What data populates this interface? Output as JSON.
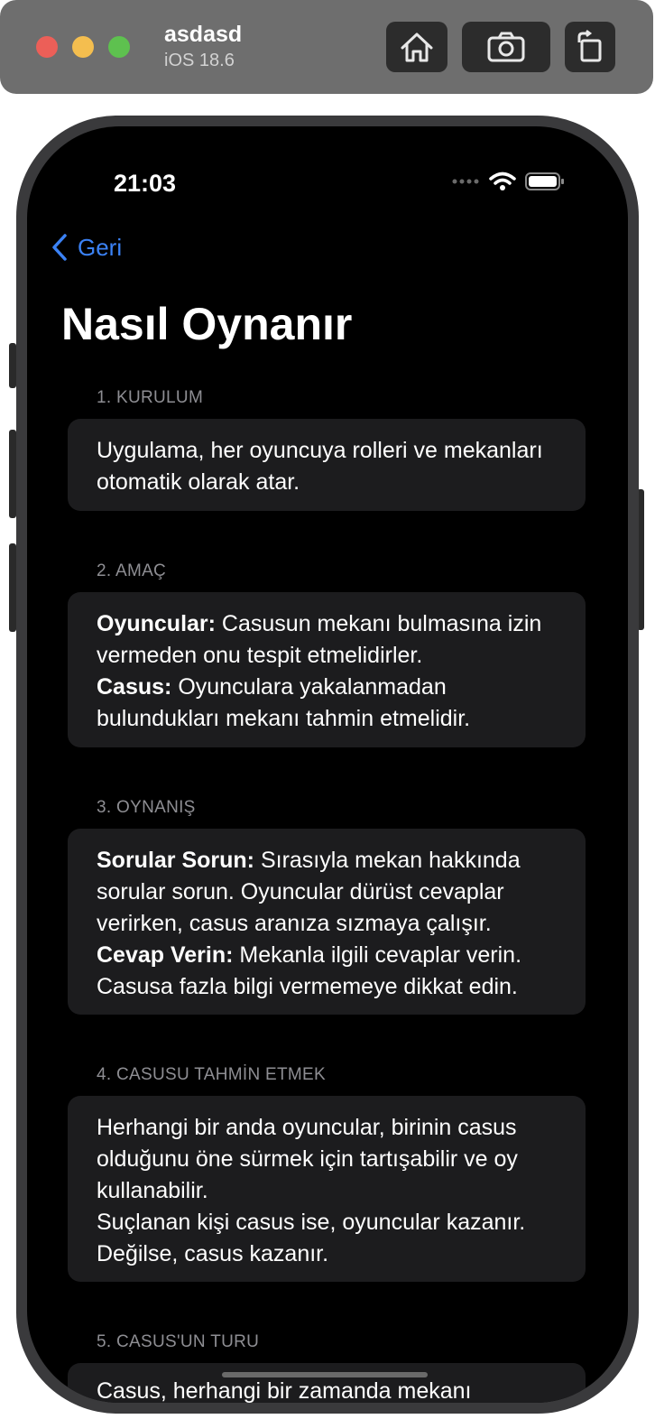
{
  "simulator": {
    "device_name": "asdasd",
    "os_version": "iOS 18.6",
    "buttons": {
      "home": "home-icon",
      "screenshot": "camera-icon",
      "rotate": "rotate-icon"
    }
  },
  "status_bar": {
    "time": "21:03"
  },
  "nav": {
    "back_label": "Geri",
    "title": "Nasıl Oynanır"
  },
  "sections": [
    {
      "header": "1. KURULUM",
      "paragraphs": [
        {
          "text": "Uygulama, her oyuncuya rolleri ve mekanları otomatik olarak atar."
        }
      ]
    },
    {
      "header": "2. AMAÇ",
      "paragraphs": [
        {
          "bold": "Oyuncular:",
          "text": " Casusun mekanı bulmasına izin vermeden onu tespit etmelidirler."
        },
        {
          "bold": "Casus:",
          "text": " Oyunculara yakalanmadan bulundukları mekanı tahmin etmelidir."
        }
      ]
    },
    {
      "header": "3. OYNANIŞ",
      "paragraphs": [
        {
          "bold": "Sorular Sorun:",
          "text": " Sırasıyla mekan hakkında sorular sorun. Oyuncular dürüst cevaplar verirken, casus aranıza sızmaya çalışır."
        },
        {
          "bold": "Cevap Verin:",
          "text": " Mekanla ilgili cevaplar verin. Casusa fazla bilgi vermemeye dikkat edin."
        }
      ]
    },
    {
      "header": "4. CASUSU TAHMİN ETMEK",
      "paragraphs": [
        {
          "text": "Herhangi bir anda oyuncular, birinin casus olduğunu öne sürmek için tartışabilir ve oy kullanabilir."
        },
        {
          "text": "Suçlanan kişi casus ise, oyuncular kazanır. Değilse, casus kazanır."
        }
      ]
    },
    {
      "header": "5. CASUS'UN TURU",
      "paragraphs": [
        {
          "text": "Casus, herhangi bir zamanda mekanı"
        }
      ]
    }
  ]
}
